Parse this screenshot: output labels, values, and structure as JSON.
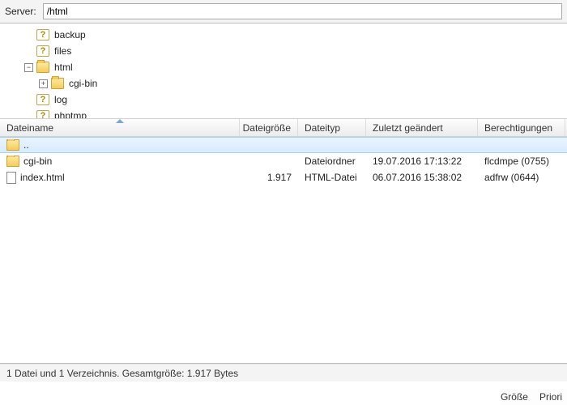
{
  "server": {
    "label": "Server:",
    "path": "/html"
  },
  "tree": {
    "items": [
      {
        "depth": 1,
        "expander": null,
        "icon": "question",
        "label": "backup"
      },
      {
        "depth": 1,
        "expander": null,
        "icon": "question",
        "label": "files"
      },
      {
        "depth": 1,
        "expander": "minus",
        "icon": "folder",
        "label": "html"
      },
      {
        "depth": 2,
        "expander": "plus",
        "icon": "folder",
        "label": "cgi-bin"
      },
      {
        "depth": 1,
        "expander": null,
        "icon": "question",
        "label": "log"
      },
      {
        "depth": 1,
        "expander": null,
        "icon": "question",
        "label": "phptmp"
      }
    ]
  },
  "list": {
    "columns": {
      "name": "Dateiname",
      "size": "Dateigröße",
      "type": "Dateityp",
      "modified": "Zuletzt geändert",
      "perm": "Berechtigungen"
    },
    "rows": [
      {
        "icon": "folder",
        "name": "..",
        "size": "",
        "type": "",
        "modified": "",
        "perm": "",
        "selected": true
      },
      {
        "icon": "folder",
        "name": "cgi-bin",
        "size": "",
        "type": "Dateiordner",
        "modified": "19.07.2016 17:13:22",
        "perm": "flcdmpe (0755)"
      },
      {
        "icon": "file",
        "name": "index.html",
        "size": "1.917",
        "type": "HTML-Datei",
        "modified": "06.07.2016 15:38:02",
        "perm": "adfrw (0644)"
      }
    ]
  },
  "status": "1 Datei und 1 Verzeichnis. Gesamtgröße: 1.917 Bytes",
  "footer": {
    "col1": "Größe",
    "col2": "Priori"
  }
}
